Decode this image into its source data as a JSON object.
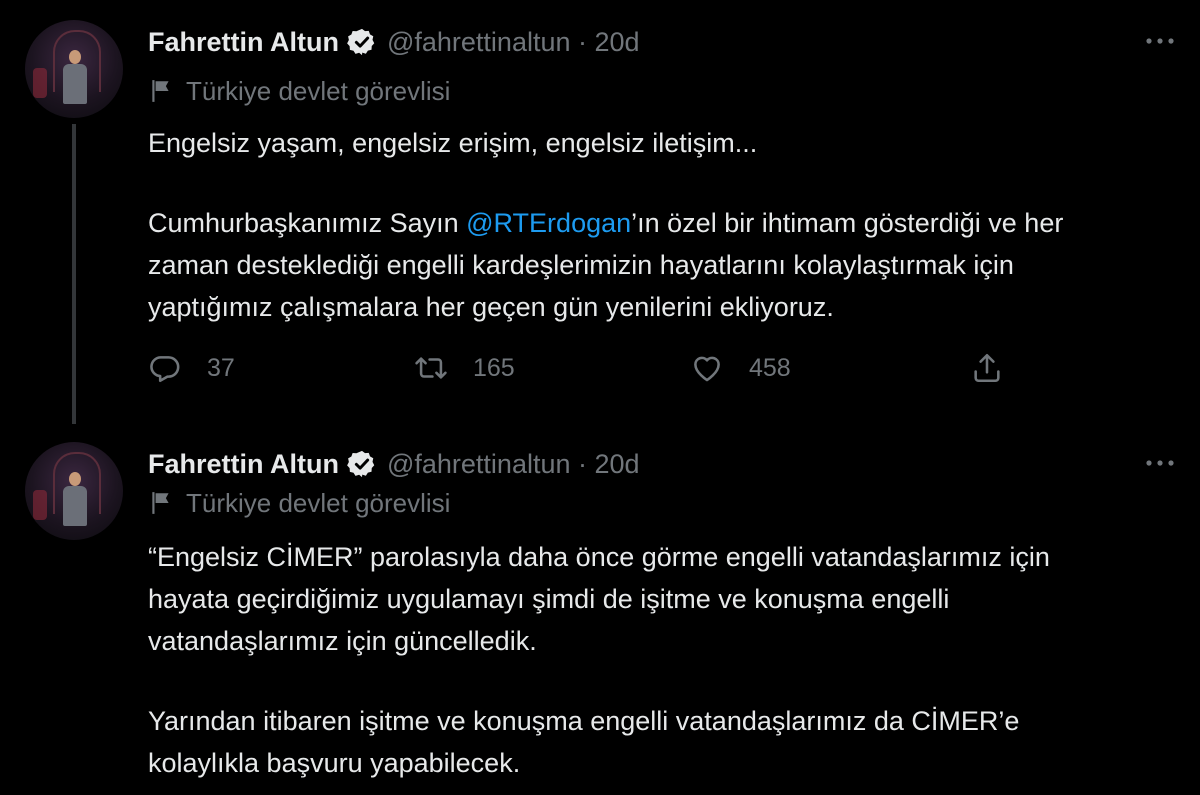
{
  "tweets": [
    {
      "author": {
        "name": "Fahrettin Altun",
        "handle": "@fahrettinaltun · 20d"
      },
      "label": "Türkiye devlet görevlisi",
      "text_line1": "Engelsiz yaşam, engelsiz erişim, engelsiz iletişim...",
      "text_line2_pre": "Cumhurbaşkanımız Sayın ",
      "text_line2_mention": "@RTErdogan",
      "text_line2_post": "’ın özel bir ihtimam gösterdiği ve her",
      "text_line3": "zaman desteklediği engelli kardeşlerimizin hayatlarını kolaylaştırmak için",
      "text_line4": "yaptığımız çalışmalara her geçen gün yenilerini ekliyoruz.",
      "counts": {
        "replies": "37",
        "retweets": "165",
        "likes": "458"
      }
    },
    {
      "author": {
        "name": "Fahrettin Altun",
        "handle": "@fahrettinaltun · 20d"
      },
      "label": "Türkiye devlet görevlisi",
      "text_line1": "“Engelsiz CİMER” parolasıyla daha önce görme engelli vatandaşlarımız için",
      "text_line2": "hayata geçirdiğimiz uygulamayı şimdi de işitme ve konuşma engelli",
      "text_line3": "vatandaşlarımız için güncelledik.",
      "text_line4": "Yarından itibaren işitme ve konuşma engelli vatandaşlarımız da CİMER’e",
      "text_line5": "kolaylıkla başvuru yapabilecek."
    }
  ],
  "colors": {
    "background": "#000000",
    "text": "#e7e9ea",
    "muted": "#71767b",
    "link": "#1d9bf0",
    "thread_line": "#333639"
  },
  "icons": [
    "verified-badge-icon",
    "more-icon",
    "flag-icon",
    "reply-icon",
    "retweet-icon",
    "like-icon",
    "share-icon"
  ]
}
